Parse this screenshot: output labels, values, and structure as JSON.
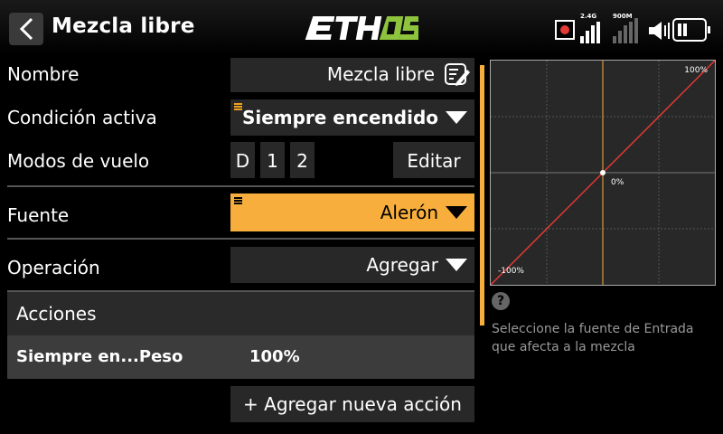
{
  "header": {
    "title": "Mezcla libre",
    "logo_text": "ETHOS",
    "status": {
      "signal_24g_label": "2.4G",
      "signal_900m_label": "900M"
    }
  },
  "form": {
    "name": {
      "label": "Nombre",
      "value": "Mezcla libre"
    },
    "active_condition": {
      "label": "Condición activa",
      "value": "Siempre encendido"
    },
    "flight_modes": {
      "label": "Modos de vuelo",
      "modes": [
        "D",
        "1",
        "2"
      ],
      "edit_label": "Editar"
    },
    "source": {
      "label": "Fuente",
      "value": "Alerón"
    },
    "operation": {
      "label": "Operación",
      "value": "Agregar"
    },
    "actions": {
      "header": "Acciones",
      "rows": [
        {
          "name": "Siempre en...Peso",
          "value": "100%"
        }
      ],
      "add_label": "+ Agregar nueva acción"
    }
  },
  "graph": {
    "label_max": "100%",
    "label_mid": "0%",
    "label_min": "-100%",
    "curve_color": "#e53935",
    "center_line_color": "#f7ae3c"
  },
  "help": {
    "icon": "?",
    "text_line1": "Seleccione la fuente de Entrada",
    "text_line2": "que afecta a la mezcla"
  },
  "colors": {
    "accent": "#f7ae3c",
    "field_bg": "#282828"
  }
}
